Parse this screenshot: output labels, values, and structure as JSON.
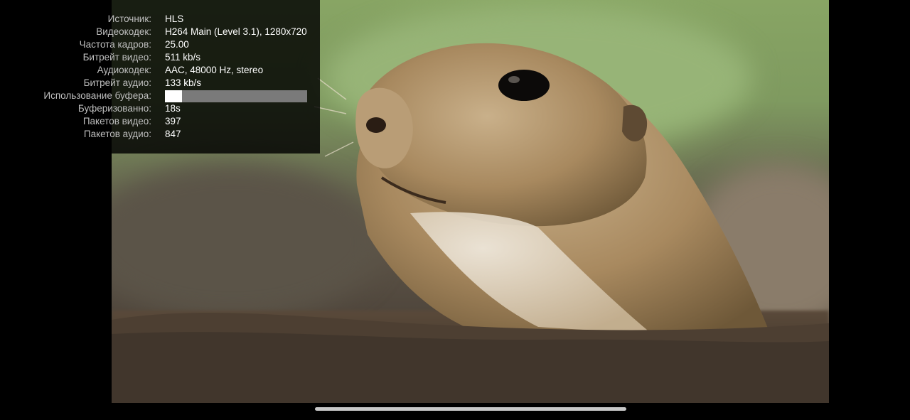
{
  "stats": {
    "rows": [
      {
        "label": "Источник:",
        "value": "HLS"
      },
      {
        "label": "Видеокодек:",
        "value": "H264 Main (Level 3.1), 1280x720"
      },
      {
        "label": "Частота кадров:",
        "value": "25.00"
      },
      {
        "label": "Битрейт видео:",
        "value": "511 kb/s"
      },
      {
        "label": "Аудиокодек:",
        "value": "AAC, 48000 Hz, stereo"
      },
      {
        "label": "Битрейт аудио:",
        "value": "133 kb/s"
      },
      {
        "label": "Использование буфера:",
        "value": ""
      },
      {
        "label": "Буферизованно:",
        "value": "18s"
      },
      {
        "label": "Пакетов видео:",
        "value": "397"
      },
      {
        "label": "Пакетов аудио:",
        "value": "847"
      }
    ],
    "buffer_usage_fraction": 0.12
  },
  "video": {
    "subject": "prairie dog close-up"
  }
}
